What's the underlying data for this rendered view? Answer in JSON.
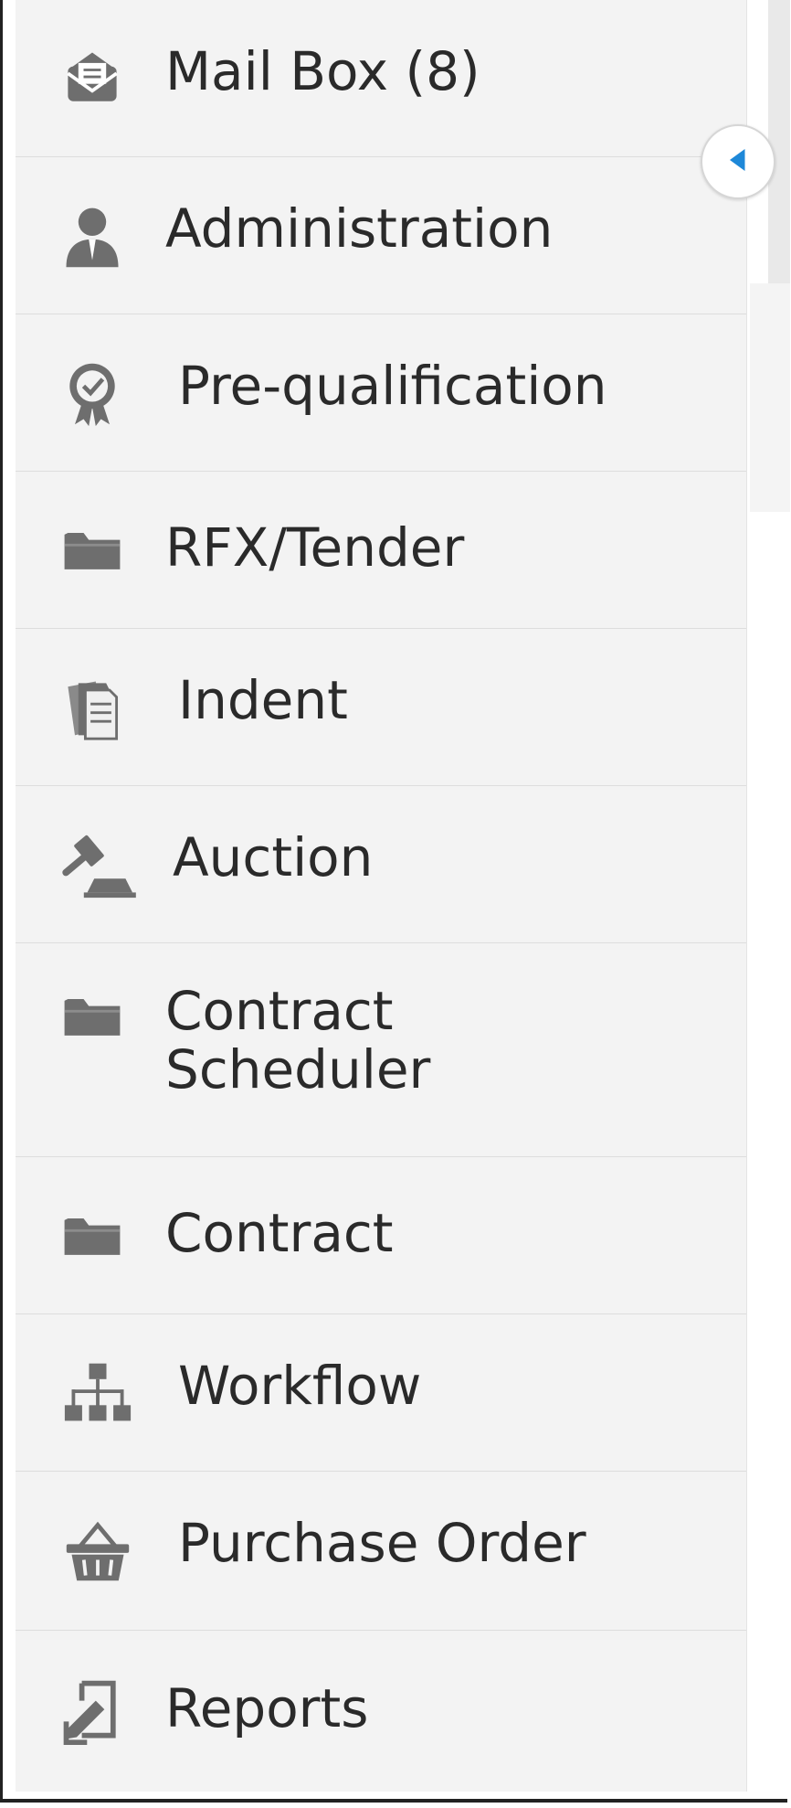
{
  "sidebar": {
    "items": [
      {
        "label": "Mail Box (8)",
        "icon": "mail-envelope-icon"
      },
      {
        "label": "Administration",
        "icon": "user-admin-icon"
      },
      {
        "label": "Pre-qualification",
        "icon": "certificate-badge-icon"
      },
      {
        "label": "RFX/Tender",
        "icon": "folder-icon"
      },
      {
        "label": "Indent",
        "icon": "documents-stack-icon"
      },
      {
        "label": "Auction",
        "icon": "gavel-icon"
      },
      {
        "label": "Contract\nScheduler",
        "icon": "folder-icon"
      },
      {
        "label": "Contract",
        "icon": "folder-icon"
      },
      {
        "label": "Workflow",
        "icon": "sitemap-icon"
      },
      {
        "label": "Purchase Order",
        "icon": "basket-icon"
      },
      {
        "label": "Reports",
        "icon": "report-edit-icon"
      }
    ]
  },
  "toggle": {
    "icon": "caret-left-icon"
  },
  "colors": {
    "sidebar_bg": "#f3f3f3",
    "text": "#2a2a2a",
    "icon": "#6e6e6e",
    "toggle_arrow": "#1e88d8"
  }
}
